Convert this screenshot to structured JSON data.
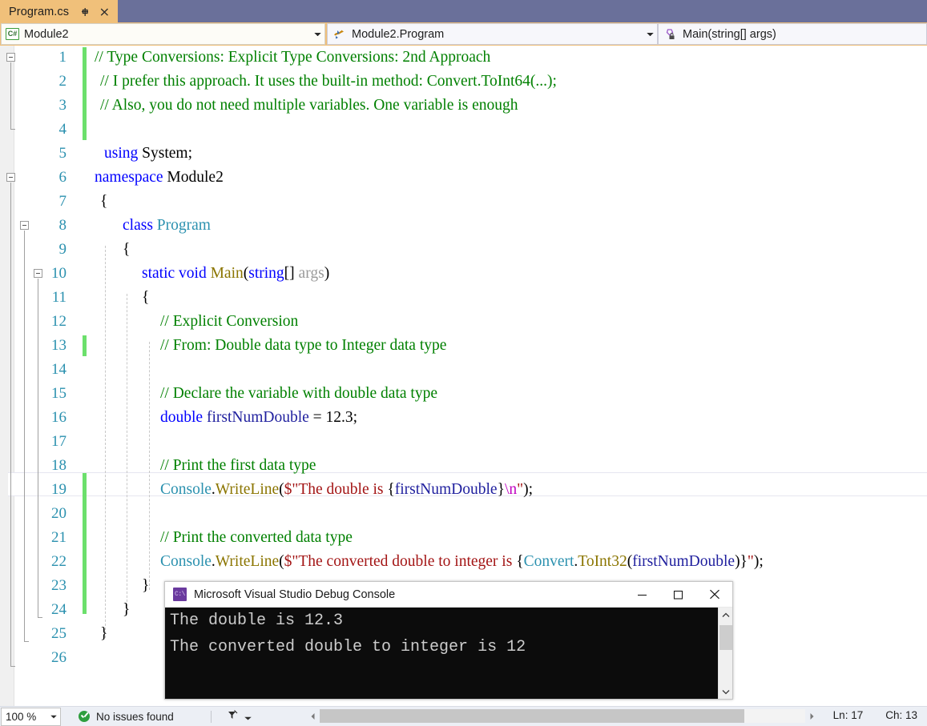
{
  "tab": {
    "title": "Program.cs",
    "pin_icon": "pin-icon",
    "close_icon": "close-icon"
  },
  "navbar": {
    "type_combo": {
      "icon": "csharp-file-icon",
      "value": "Module2"
    },
    "class_combo": {
      "icon": "class-members-icon",
      "value": "Module2.Program"
    },
    "member_combo": {
      "icon": "method-private-icon",
      "value": "Main(string[] args)"
    }
  },
  "editor": {
    "line_numbers": [
      1,
      2,
      3,
      4,
      5,
      6,
      7,
      8,
      9,
      10,
      11,
      12,
      13,
      14,
      15,
      16,
      17,
      18,
      19,
      20,
      21,
      22,
      23,
      24,
      25,
      26
    ],
    "current_line": 17,
    "changed_lines": [
      [
        1,
        4
      ],
      [
        13,
        13
      ],
      [
        17,
        22
      ]
    ],
    "lines": [
      "// Type Conversions: Explicit Type Conversions: 2nd Approach",
      "// I prefer this approach. It uses the built-in method: Convert.ToInt64(...);",
      "// Also, you do not need multiple variables. One variable is enough",
      "",
      "using System;",
      "namespace Module2",
      "{",
      "    class Program",
      "    {",
      "        static void Main(string[] args)",
      "        {",
      "            // Explicit Conversion",
      "            // From: Double data type to Integer data type",
      "",
      "            // Declare the variable with double data type",
      "            double firstNumDouble = 12.3;",
      "",
      "            // Print the first data type",
      "            Console.WriteLine($\"The double is {firstNumDouble}\\n\");",
      "",
      "            // Print the converted data type",
      "            Console.WriteLine($\"The converted double to integer is {Convert.ToInt32(firstNumDouble)}\");",
      "        }",
      "    }",
      "}",
      ""
    ]
  },
  "console": {
    "title": "Microsoft Visual Studio Debug Console",
    "app_icon": "console-app-icon",
    "minimize_label": "minimize-icon",
    "maximize_label": "maximize-icon",
    "close_label": "close-icon",
    "output": [
      "The double is 12.3",
      "",
      "The converted double to integer is 12"
    ]
  },
  "statusbar": {
    "zoom": "100 %",
    "issues": "No issues found",
    "issues_icon": "success-check-icon",
    "filter_icon": "funnel-icon",
    "line": "Ln: 17",
    "column": "Ch: 13"
  },
  "colors": {
    "tab_active": "#f0c07a",
    "tabstrip": "#6a709a",
    "keyword": "#0000ff",
    "comment": "#008000",
    "type": "#2b91af",
    "method": "#8b7500",
    "string": "#a31515",
    "escape": "#c000c0",
    "variable": "#1f1f9e",
    "changebar": "#6ce06c",
    "linenumber": "#2b91af",
    "console_bg": "#0c0c0c",
    "console_fg": "#cccccc"
  }
}
